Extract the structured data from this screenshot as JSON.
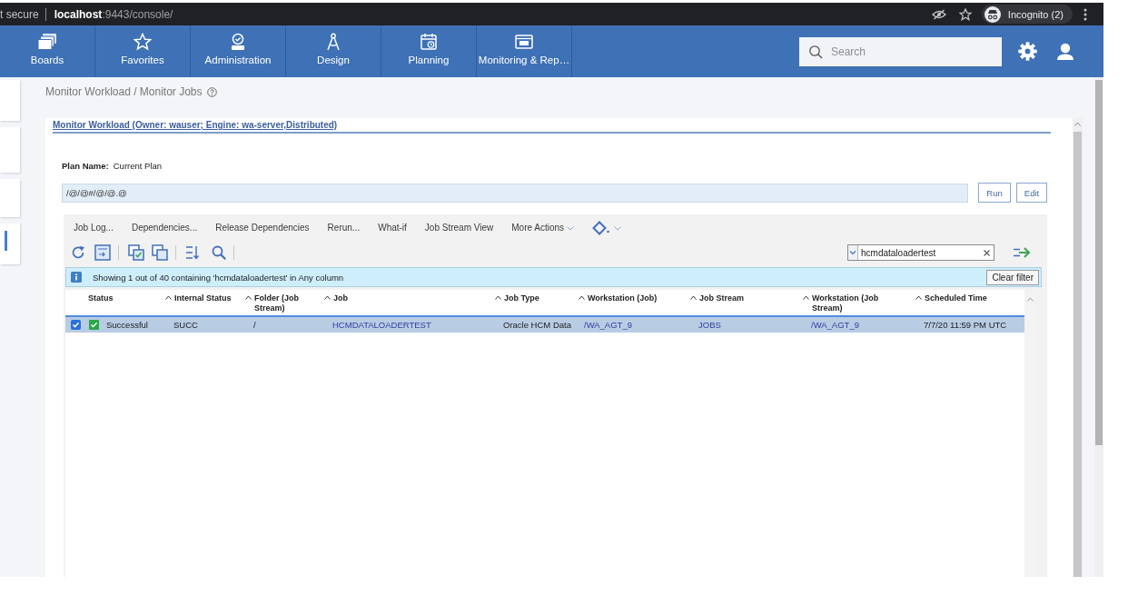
{
  "browser": {
    "security": "t secure",
    "url": "**localhost**:9443/console/",
    "profile": "Incognito (2)"
  },
  "nav": {
    "items": [
      "Boards",
      "Favorites",
      "Administration",
      "Design",
      "Planning",
      "Monitoring & Rep…"
    ],
    "search": {
      "placeholder": "Search"
    }
  },
  "breadcrumb": "Monitor Workload / Monitor Jobs",
  "panel": {
    "title": "Monitor Workload (Owner: wauser; Engine: wa-server,Distributed)",
    "plan_label": "Plan Name:",
    "plan_value": "Current Plan",
    "query": "/@/@#/@/@.@",
    "buttons": [
      "Run",
      "Edit"
    ]
  },
  "toolbar": {
    "actions": [
      {
        "label": "Job Log...",
        "dropdown": false
      },
      {
        "label": "Dependencies...",
        "dropdown": false
      },
      {
        "label": "Release Dependencies",
        "dropdown": false
      },
      {
        "label": "Rerun...",
        "dropdown": false
      },
      {
        "label": "What-if",
        "dropdown": false
      },
      {
        "label": "Job Stream View",
        "dropdown": false
      },
      {
        "label": "More Actions",
        "dropdown": true
      }
    ],
    "filter": {
      "value": "hcmdataloadertest"
    }
  },
  "info_bar": {
    "message": "Showing 1 out of 40 containing 'hcmdataloadertest' in Any column",
    "button": "Clear filter"
  },
  "table": {
    "columns": [
      {
        "label": "Status",
        "sortable": false
      },
      {
        "label": "Internal Status",
        "sortable": true
      },
      {
        "label": "Folder (Job Stream)",
        "sortable": true
      },
      {
        "label": "Job",
        "sortable": true
      },
      {
        "label": "Job Type",
        "sortable": true
      },
      {
        "label": "Workstation (Job)",
        "sortable": true
      },
      {
        "label": "Job Stream",
        "sortable": true
      },
      {
        "label": "Workstation (Job Stream)",
        "sortable": true
      },
      {
        "label": "Scheduled Time",
        "sortable": true
      }
    ],
    "rows": [
      {
        "selected": true,
        "checked": true,
        "cells": [
          {
            "kind": "status",
            "text": "Successful"
          },
          {
            "kind": "text",
            "text": "SUCC"
          },
          {
            "kind": "text",
            "text": "/"
          },
          {
            "kind": "link",
            "text": "HCMDATALOADERTEST"
          },
          {
            "kind": "text",
            "text": "Oracle HCM Data"
          },
          {
            "kind": "link",
            "text": "/WA_AGT_9"
          },
          {
            "kind": "link",
            "text": "JOBS"
          },
          {
            "kind": "link",
            "text": "/WA_AGT_9"
          },
          {
            "kind": "text",
            "text": "7/7/20 11:59 PM UTC"
          }
        ]
      }
    ]
  }
}
